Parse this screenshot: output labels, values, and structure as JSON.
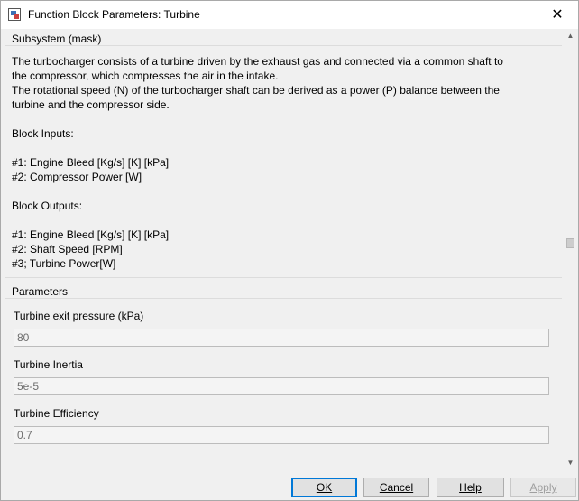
{
  "window": {
    "title": "Function Block Parameters: Turbine",
    "close_symbol": "✕",
    "icon": "simulink-block-icon"
  },
  "mask": {
    "group_title": "Subsystem (mask)",
    "lines": [
      "The turbocharger consists of a turbine driven by the exhaust gas and connected via a common shaft to",
      "the compressor, which compresses the air in the intake.",
      "The rotational speed (N) of the turbocharger shaft can be derived as a power (P) balance between the",
      "turbine and the compressor side.",
      "Block Inputs:",
      "#1: Engine Bleed [Kg/s] [K] [kPa]",
      "#2: Compressor Power [W]",
      "Block Outputs:",
      "#1: Engine Bleed [Kg/s] [K] [kPa]",
      "#2: Shaft Speed [RPM]",
      "#3; Turbine Power[W]"
    ]
  },
  "parameters": {
    "group_title": "Parameters",
    "fields": [
      {
        "label": "Turbine exit pressure (kPa)",
        "value": "80"
      },
      {
        "label": "Turbine Inertia",
        "value": "5e-5"
      },
      {
        "label": "Turbine Efficiency",
        "value": "0.7"
      }
    ]
  },
  "scrollbar": {
    "up_symbol": "▲",
    "down_symbol": "▼"
  },
  "buttons": {
    "ok": {
      "label": "OK"
    },
    "cancel": {
      "label": "Cancel"
    },
    "help": {
      "label": "Help"
    },
    "apply": {
      "label": "Apply"
    }
  }
}
